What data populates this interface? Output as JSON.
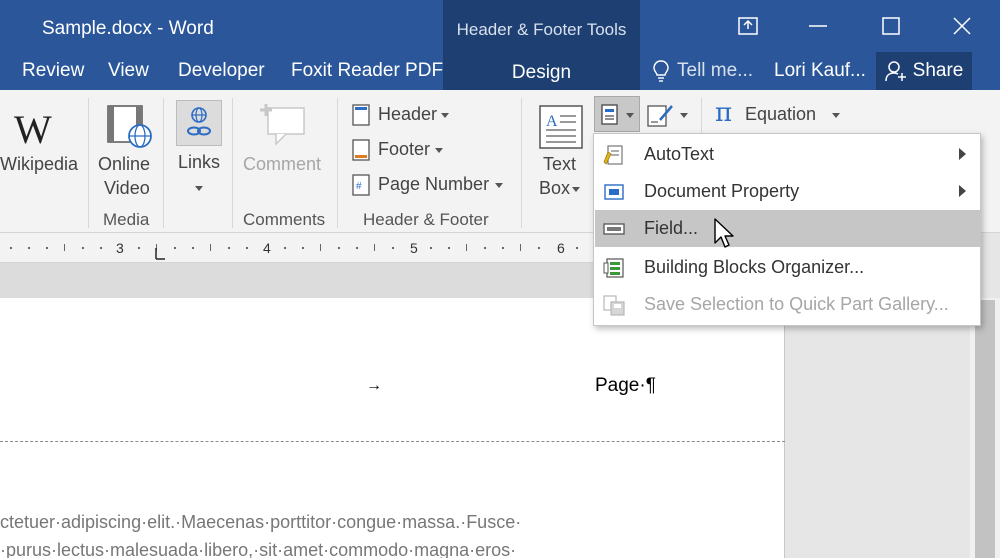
{
  "title_bar": {
    "document_title": "Sample.docx - Word",
    "contextual_title": "Header & Footer Tools",
    "contextual_tab": "Design"
  },
  "tabs": [
    "Review",
    "View",
    "Developer",
    "Foxit Reader PDF"
  ],
  "tell_me": "Tell me...",
  "user": "Lori Kauf...",
  "share": "Share",
  "ribbon": {
    "wikipedia": "Wikipedia",
    "online_video_line1": "Online",
    "online_video_line2": "Video",
    "links": "Links",
    "comment": "Comment",
    "header": "Header",
    "footer": "Footer",
    "page_number": "Page Number",
    "text_box_line1": "Text",
    "text_box_line2": "Box",
    "equation": "Equation",
    "groups": {
      "media": "Media",
      "comments": "Comments",
      "header_footer": "Header & Footer"
    }
  },
  "ruler": {
    "numbers": [
      "3",
      "4",
      "5",
      "6"
    ]
  },
  "quick_parts_menu": {
    "items": [
      {
        "label": "AutoText",
        "icon": "autotext-icon",
        "submenu": true
      },
      {
        "label": "Document Property",
        "icon": "document-property-icon",
        "submenu": true
      },
      {
        "label": "Field...",
        "icon": "field-icon",
        "highlighted": true
      },
      {
        "label": "Building Blocks Organizer...",
        "icon": "building-blocks-icon"
      },
      {
        "label": "Save Selection to Quick Part Gallery...",
        "icon": "save-selection-icon",
        "disabled": true
      }
    ]
  },
  "document": {
    "header_field": "Page·¶",
    "body_line1": "ctetuer·adipiscing·elit.·Maecenas·porttitor·congue·massa.·Fusce·",
    "body_line2": "·purus·lectus·malesuada·libero,·sit·amet·commodo·magna·eros·"
  },
  "colors": {
    "title_bar": "#2b579a",
    "contextual_bar": "#1e3f71",
    "ribbon": "#f3f3f3",
    "menu_highlight": "#c6c6c6"
  }
}
